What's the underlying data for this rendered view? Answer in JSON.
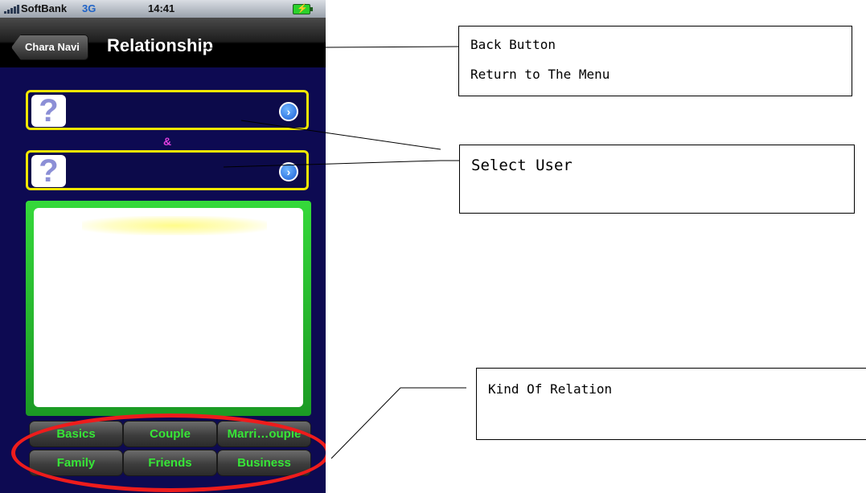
{
  "status_bar": {
    "carrier": "SoftBank",
    "network": "3G",
    "time": "14:41"
  },
  "nav_bar": {
    "back_label": "Chara Navi",
    "title": "Relationship"
  },
  "user_slots": [
    {
      "avatar_glyph": "?"
    },
    {
      "avatar_glyph": "?"
    }
  ],
  "separator": "&",
  "relation_tabs": [
    "Basics",
    "Couple",
    "Marri…ouple",
    "Family",
    "Friends",
    "Business"
  ],
  "annotations": {
    "back_button": {
      "line1": "Back Button",
      "line2": "Return to The Menu"
    },
    "select_user": {
      "line1": "Select User"
    },
    "kind_of_relation": {
      "line1": "Kind Of Relation"
    }
  },
  "colors": {
    "background": "#0d0a52",
    "slot_border": "#f2e600",
    "panel_green": "#35d93a",
    "tab_text": "#37e637",
    "highlight_ring": "#ee1c1c",
    "ampersand": "#e040e0"
  },
  "icons": [
    "signal-icon",
    "battery-icon",
    "question-avatar-icon",
    "disclosure-arrow-icon"
  ]
}
